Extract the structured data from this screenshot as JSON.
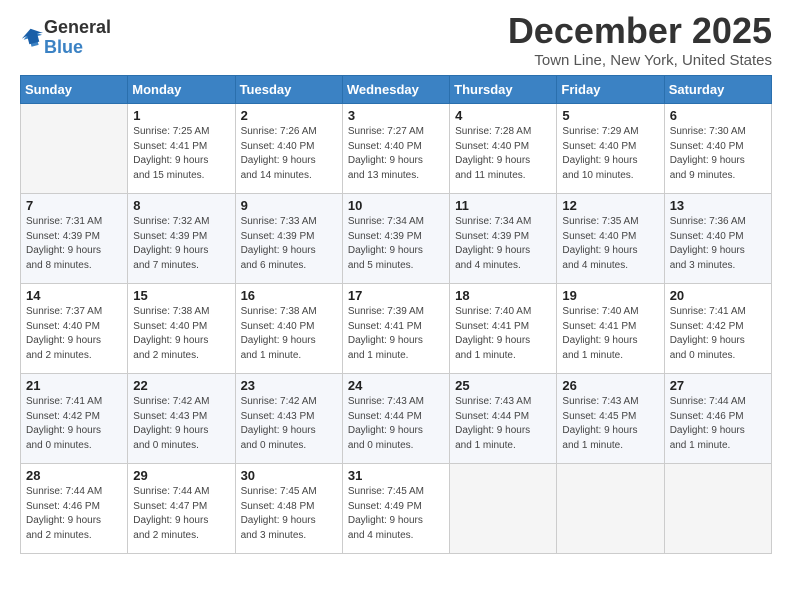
{
  "logo": {
    "general": "General",
    "blue": "Blue"
  },
  "header": {
    "month_year": "December 2025",
    "location": "Town Line, New York, United States"
  },
  "days_of_week": [
    "Sunday",
    "Monday",
    "Tuesday",
    "Wednesday",
    "Thursday",
    "Friday",
    "Saturday"
  ],
  "weeks": [
    [
      {
        "day": "",
        "info": ""
      },
      {
        "day": "1",
        "info": "Sunrise: 7:25 AM\nSunset: 4:41 PM\nDaylight: 9 hours\nand 15 minutes."
      },
      {
        "day": "2",
        "info": "Sunrise: 7:26 AM\nSunset: 4:40 PM\nDaylight: 9 hours\nand 14 minutes."
      },
      {
        "day": "3",
        "info": "Sunrise: 7:27 AM\nSunset: 4:40 PM\nDaylight: 9 hours\nand 13 minutes."
      },
      {
        "day": "4",
        "info": "Sunrise: 7:28 AM\nSunset: 4:40 PM\nDaylight: 9 hours\nand 11 minutes."
      },
      {
        "day": "5",
        "info": "Sunrise: 7:29 AM\nSunset: 4:40 PM\nDaylight: 9 hours\nand 10 minutes."
      },
      {
        "day": "6",
        "info": "Sunrise: 7:30 AM\nSunset: 4:40 PM\nDaylight: 9 hours\nand 9 minutes."
      }
    ],
    [
      {
        "day": "7",
        "info": "Sunrise: 7:31 AM\nSunset: 4:39 PM\nDaylight: 9 hours\nand 8 minutes."
      },
      {
        "day": "8",
        "info": "Sunrise: 7:32 AM\nSunset: 4:39 PM\nDaylight: 9 hours\nand 7 minutes."
      },
      {
        "day": "9",
        "info": "Sunrise: 7:33 AM\nSunset: 4:39 PM\nDaylight: 9 hours\nand 6 minutes."
      },
      {
        "day": "10",
        "info": "Sunrise: 7:34 AM\nSunset: 4:39 PM\nDaylight: 9 hours\nand 5 minutes."
      },
      {
        "day": "11",
        "info": "Sunrise: 7:34 AM\nSunset: 4:39 PM\nDaylight: 9 hours\nand 4 minutes."
      },
      {
        "day": "12",
        "info": "Sunrise: 7:35 AM\nSunset: 4:40 PM\nDaylight: 9 hours\nand 4 minutes."
      },
      {
        "day": "13",
        "info": "Sunrise: 7:36 AM\nSunset: 4:40 PM\nDaylight: 9 hours\nand 3 minutes."
      }
    ],
    [
      {
        "day": "14",
        "info": "Sunrise: 7:37 AM\nSunset: 4:40 PM\nDaylight: 9 hours\nand 2 minutes."
      },
      {
        "day": "15",
        "info": "Sunrise: 7:38 AM\nSunset: 4:40 PM\nDaylight: 9 hours\nand 2 minutes."
      },
      {
        "day": "16",
        "info": "Sunrise: 7:38 AM\nSunset: 4:40 PM\nDaylight: 9 hours\nand 1 minute."
      },
      {
        "day": "17",
        "info": "Sunrise: 7:39 AM\nSunset: 4:41 PM\nDaylight: 9 hours\nand 1 minute."
      },
      {
        "day": "18",
        "info": "Sunrise: 7:40 AM\nSunset: 4:41 PM\nDaylight: 9 hours\nand 1 minute."
      },
      {
        "day": "19",
        "info": "Sunrise: 7:40 AM\nSunset: 4:41 PM\nDaylight: 9 hours\nand 1 minute."
      },
      {
        "day": "20",
        "info": "Sunrise: 7:41 AM\nSunset: 4:42 PM\nDaylight: 9 hours\nand 0 minutes."
      }
    ],
    [
      {
        "day": "21",
        "info": "Sunrise: 7:41 AM\nSunset: 4:42 PM\nDaylight: 9 hours\nand 0 minutes."
      },
      {
        "day": "22",
        "info": "Sunrise: 7:42 AM\nSunset: 4:43 PM\nDaylight: 9 hours\nand 0 minutes."
      },
      {
        "day": "23",
        "info": "Sunrise: 7:42 AM\nSunset: 4:43 PM\nDaylight: 9 hours\nand 0 minutes."
      },
      {
        "day": "24",
        "info": "Sunrise: 7:43 AM\nSunset: 4:44 PM\nDaylight: 9 hours\nand 0 minutes."
      },
      {
        "day": "25",
        "info": "Sunrise: 7:43 AM\nSunset: 4:44 PM\nDaylight: 9 hours\nand 1 minute."
      },
      {
        "day": "26",
        "info": "Sunrise: 7:43 AM\nSunset: 4:45 PM\nDaylight: 9 hours\nand 1 minute."
      },
      {
        "day": "27",
        "info": "Sunrise: 7:44 AM\nSunset: 4:46 PM\nDaylight: 9 hours\nand 1 minute."
      }
    ],
    [
      {
        "day": "28",
        "info": "Sunrise: 7:44 AM\nSunset: 4:46 PM\nDaylight: 9 hours\nand 2 minutes."
      },
      {
        "day": "29",
        "info": "Sunrise: 7:44 AM\nSunset: 4:47 PM\nDaylight: 9 hours\nand 2 minutes."
      },
      {
        "day": "30",
        "info": "Sunrise: 7:45 AM\nSunset: 4:48 PM\nDaylight: 9 hours\nand 3 minutes."
      },
      {
        "day": "31",
        "info": "Sunrise: 7:45 AM\nSunset: 4:49 PM\nDaylight: 9 hours\nand 4 minutes."
      },
      {
        "day": "",
        "info": ""
      },
      {
        "day": "",
        "info": ""
      },
      {
        "day": "",
        "info": ""
      }
    ]
  ]
}
